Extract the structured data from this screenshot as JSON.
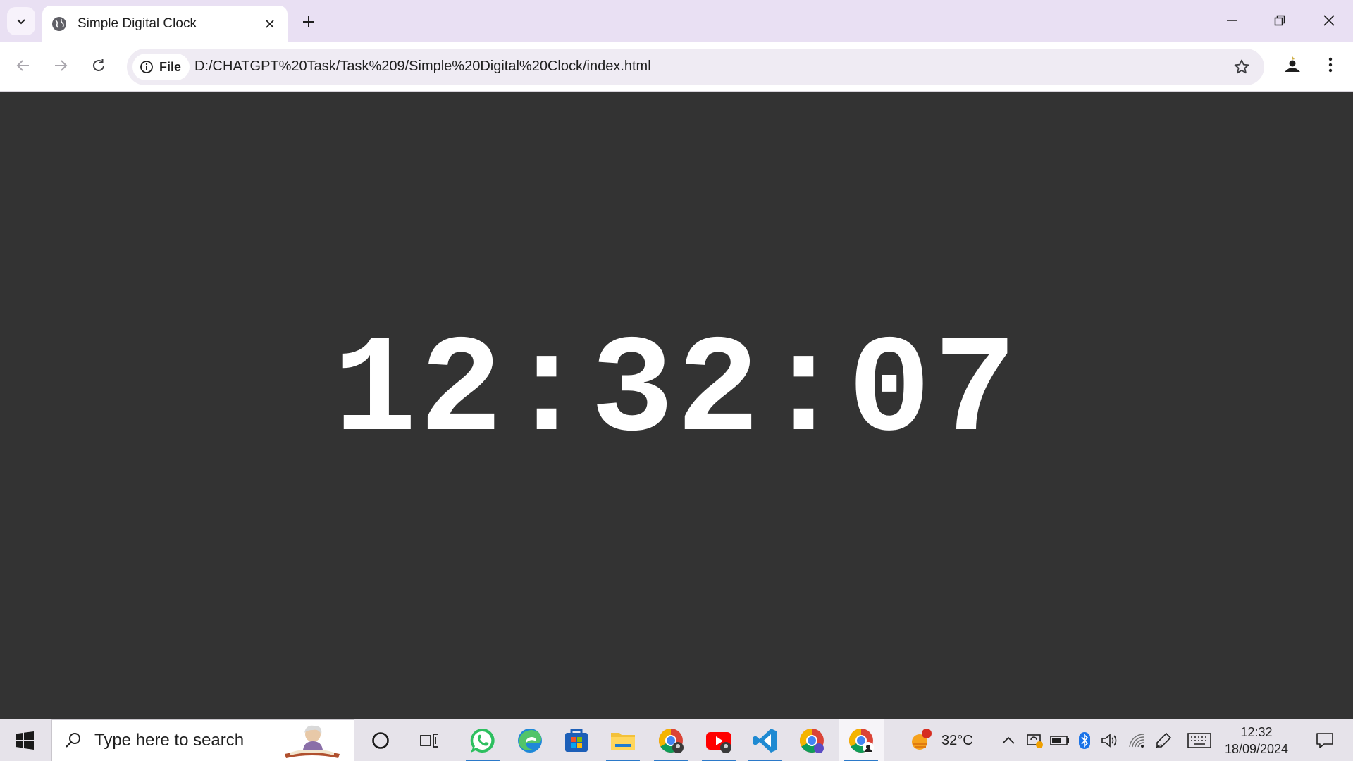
{
  "browser": {
    "tab": {
      "title": "Simple Digital Clock",
      "favicon": "globe-icon"
    },
    "address_bar": {
      "site_info_label": "File",
      "url": "D:/CHATGPT%20Task/Task%209/Simple%20Digital%20Clock/index.html"
    },
    "toolbar_icons": [
      "back-arrow-icon",
      "forward-arrow-icon",
      "reload-icon",
      "bookmark-star-icon",
      "profile-avatar-icon",
      "menu-kebab-icon"
    ],
    "window_controls": [
      "minimize-icon",
      "restore-icon",
      "close-icon"
    ]
  },
  "page": {
    "clock_time": "12:32:07",
    "background_color": "#333333",
    "text_color": "#ffffff"
  },
  "taskbar": {
    "search_placeholder": "Type here to search",
    "apps": [
      "cortana-circle-icon",
      "task-view-icon",
      "whatsapp-icon",
      "edge-icon",
      "microsoft-store-icon",
      "file-explorer-icon",
      "chrome-icon",
      "youtube-icon",
      "vscode-icon",
      "chrome-icon",
      "chrome-icon"
    ],
    "weather": {
      "temperature": "32°C",
      "badge": "1"
    },
    "tray_icons": [
      "chevron-up-icon",
      "sync-icon",
      "battery-icon",
      "bluetooth-icon",
      "volume-icon",
      "wifi-icon",
      "pen-icon",
      "keyboard-icon"
    ],
    "clock": {
      "time": "12:32",
      "date": "18/09/2024"
    },
    "notification_icon": "notification-icon"
  }
}
